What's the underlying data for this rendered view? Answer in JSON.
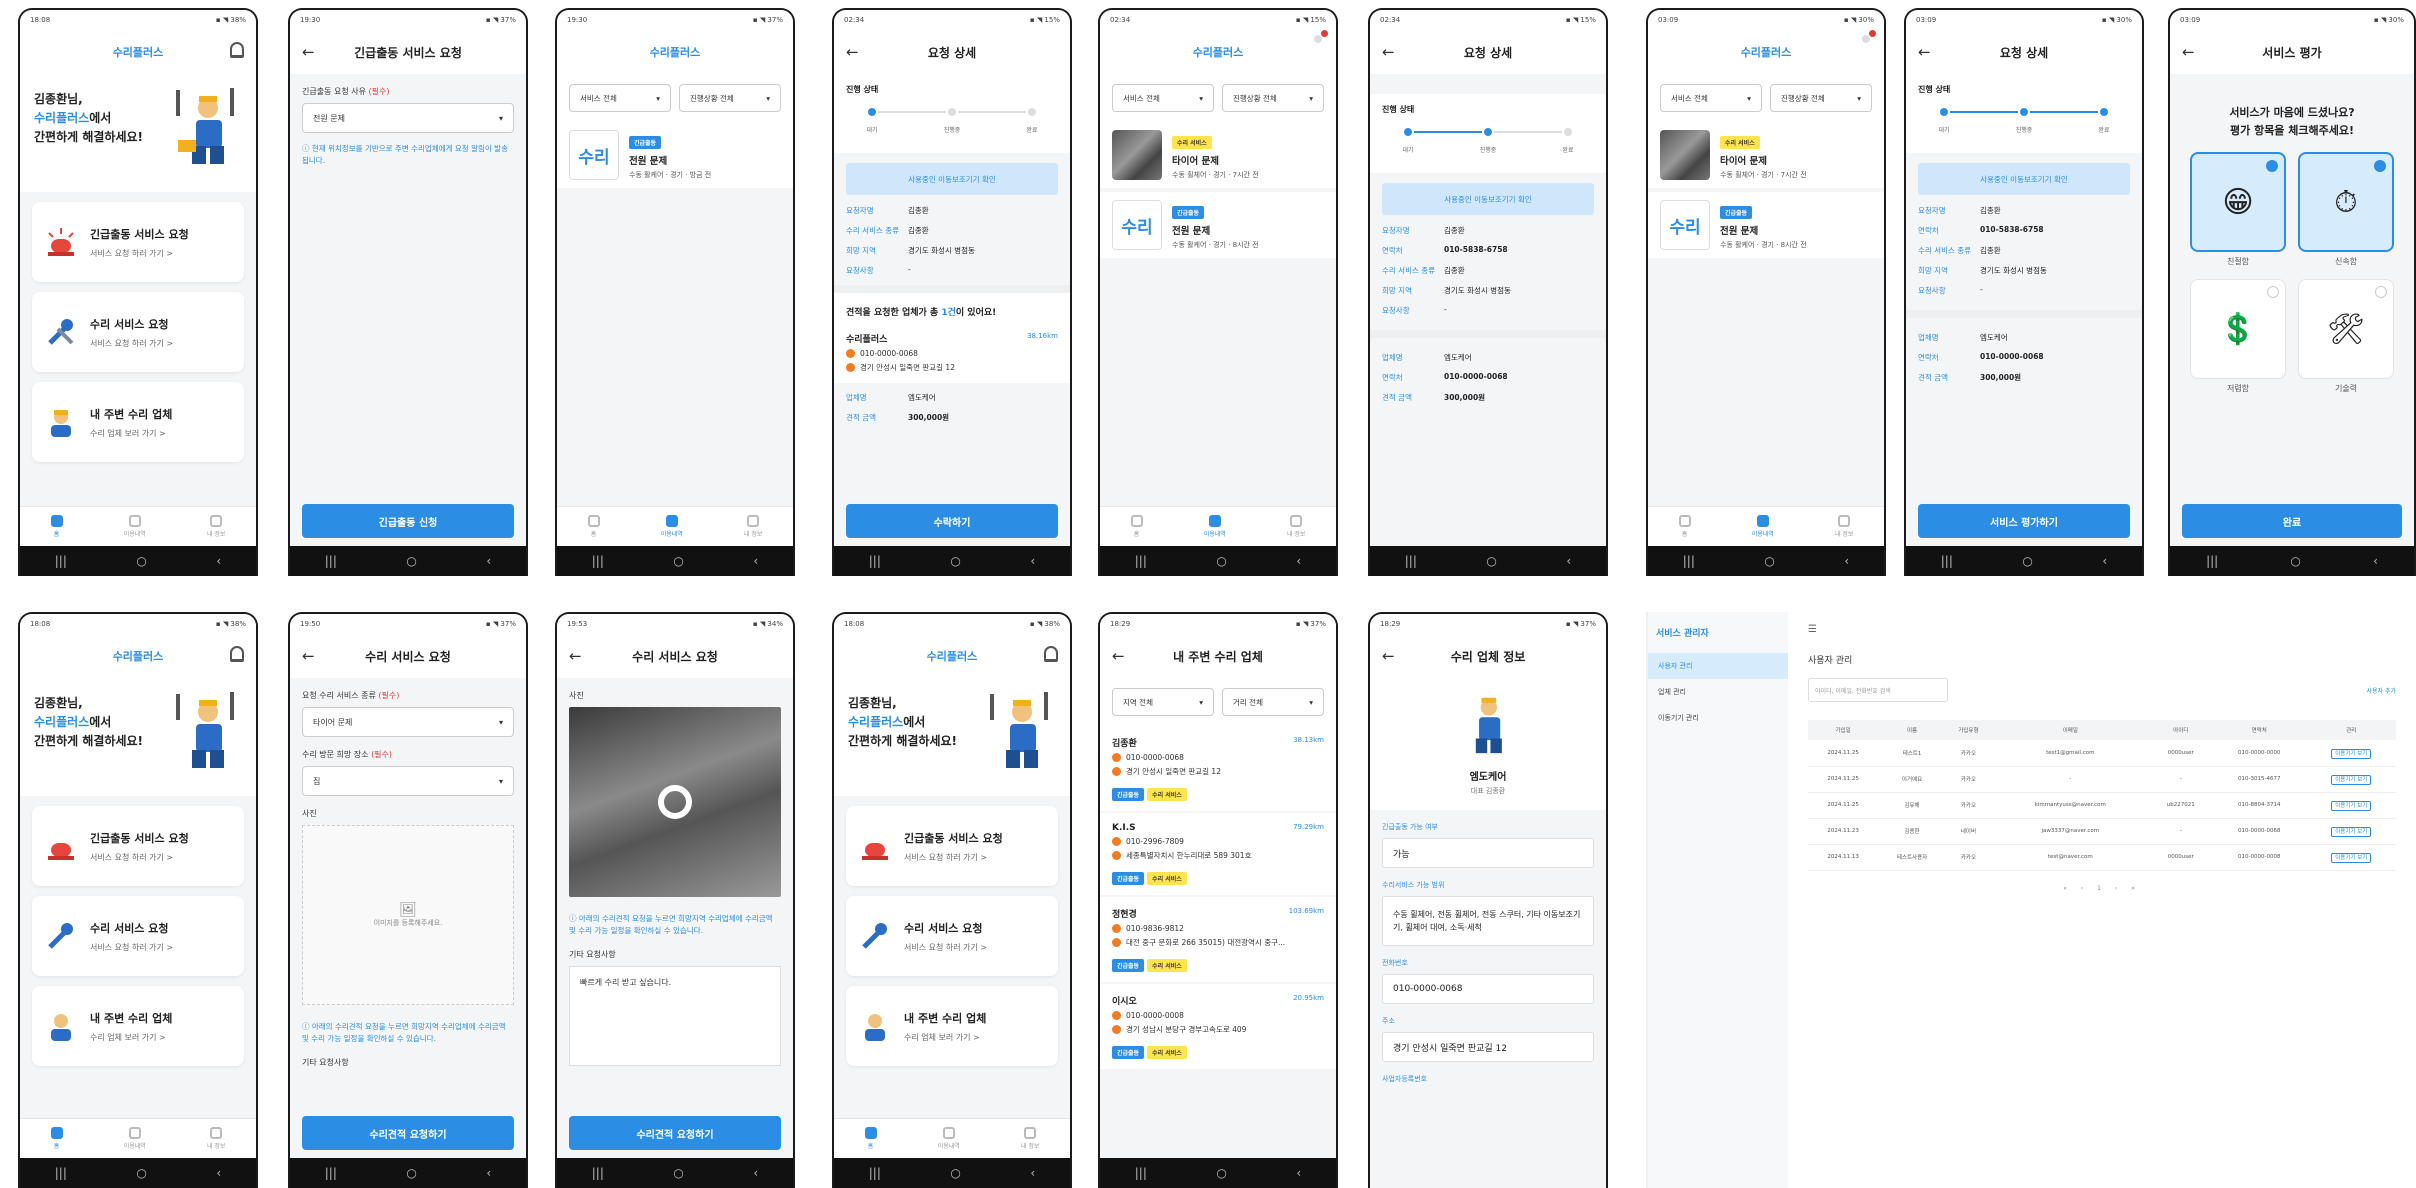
{
  "status_times": [
    "18:08",
    "19:30",
    "19:30",
    "02:34",
    "02:34",
    "02:34",
    "03:09",
    "03:09",
    "03:09",
    "18:08",
    "19:50",
    "19:53",
    "18:08",
    "18:29",
    "18:29"
  ],
  "brand": "수리플러스",
  "home": {
    "greeting_line1": "김종환님,",
    "greeting_brand": "수리플러스",
    "greeting_line2_suffix": "에서",
    "greeting_line3": "간편하게 해결하세요!",
    "menus": [
      {
        "title": "긴급출동 서비스 요청",
        "sub": "서비스 요청 하러 가기 >"
      },
      {
        "title": "수리 서비스 요청",
        "sub": "서비스 요청 하러 가기 >"
      },
      {
        "title": "내 주변 수리 업체",
        "sub": "수리 업체 보러 가기 >"
      }
    ],
    "tabs": [
      "홈",
      "이용내역",
      "내 정보"
    ]
  },
  "emergency": {
    "title": "긴급출동 서비스 요청",
    "field_label": "긴급출동 요청 사유",
    "required": "(필수)",
    "value": "전원 문제",
    "note": "ⓘ 현재 위치정보를 기반으로 주변 수리업체에게 요청 알림이 발송됩니다.",
    "submit": "긴급출동 신청"
  },
  "history": {
    "filter_service": "서비스 전체",
    "filter_status": "진행상황 전체",
    "items": [
      {
        "badge": "긴급출동",
        "badge_type": "b",
        "title": "전원 문제",
        "sub": "수동 활케어 · 경기 · 방금 전",
        "thumb": "repair"
      }
    ],
    "items2": [
      {
        "badge": "수리 서비스",
        "badge_type": "y",
        "title": "타이어 문제",
        "sub": "수동 휠체어 · 경기 · 7시간 전",
        "thumb": "photo"
      },
      {
        "badge": "긴급출동",
        "badge_type": "b",
        "title": "전원 문제",
        "sub": "수동 활케어 · 경기 · 8시간 전",
        "thumb": "repair"
      }
    ],
    "repair_thumb_text": "수리",
    "repair_thumb_tag": "긴급출동"
  },
  "detail": {
    "title": "요청 상세",
    "status_title": "진행 상태",
    "steps": [
      "대기",
      "진행중",
      "완료"
    ],
    "info_button": "사용중인 이동보조기기 확인",
    "rows_a": [
      {
        "k": "요청자명",
        "v": "김종환"
      },
      {
        "k": "수리 서비스 종류",
        "v": "김종환"
      },
      {
        "k": "희망 지역",
        "v": "경기도 화성시 병점동"
      },
      {
        "k": "요청사항",
        "v": "-"
      }
    ],
    "rows_b": [
      {
        "k": "요청자명",
        "v": "김종환"
      },
      {
        "k": "연락처",
        "v": "010-5838-6758"
      },
      {
        "k": "수리 서비스 종류",
        "v": "김종환"
      },
      {
        "k": "희망 지역",
        "v": "경기도 화성시 병점동"
      },
      {
        "k": "요청사항",
        "v": "-"
      }
    ],
    "quote_heading_pre": "견적을 요청한 업체가 총 ",
    "quote_count": "1건",
    "quote_heading_post": "이 있어요!",
    "vendor": {
      "name": "수리플러스",
      "dist": "38.16km",
      "phone": "010-0000-0068",
      "addr": "경기 안성시 일죽면 판교길 12"
    },
    "vendor_rows": [
      {
        "k": "업체명",
        "v": "엠도케어"
      },
      {
        "k": "견적 금액",
        "v": "300,000원"
      }
    ],
    "vendor_rows_b": [
      {
        "k": "업체명",
        "v": "엠도케어"
      },
      {
        "k": "연락처",
        "v": "010-0000-0068"
      },
      {
        "k": "견적 금액",
        "v": "300,000원"
      }
    ],
    "accept": "수락하기",
    "review_button": "서비스 평가하기"
  },
  "rating": {
    "title": "서비스 평가",
    "question_1": "서비스가 마음에 드셨나요?",
    "question_2": "평가 항목을 체크해주세요!",
    "items": [
      "친절함",
      "신속함",
      "저렴함",
      "기술력"
    ],
    "done": "완료"
  },
  "repair_request": {
    "title": "수리 서비스 요청",
    "type_label": "요청 수리 서비스 종류",
    "type_value": "타이어 문제",
    "place_label": "수리 방문 희망 장소",
    "place_value": "집",
    "photo_label": "사진",
    "photo_hint": "이미지를 등록해주세요.",
    "note": "ⓘ 아래의 수리견적 요청을 누르면 희망지역 수리업체에 수리금액 및 수리 가능 일정을 확인하실 수 있습니다.",
    "extra_label": "기타 요청사항",
    "extra_value": "빠르게 수리 받고 싶습니다.",
    "submit": "수리견적 요청하기"
  },
  "nearby": {
    "title": "내 주변 수리 업체",
    "filter_area": "지역 전체",
    "filter_dist": "거리 전체",
    "vendors": [
      {
        "name": "김종환",
        "dist": "38.13km",
        "phone": "010-0000-0068",
        "addr": "경기 안성시 일죽면 판교길 12"
      },
      {
        "name": "K.I.S",
        "dist": "79.29km",
        "phone": "010-2996-7809",
        "addr": "세종특별자치시 한누리대로 589 301호"
      },
      {
        "name": "정현경",
        "dist": "103.69km",
        "phone": "010-9836-9812",
        "addr": "대전 중구 문화로 266 35015) 대전광역시 중구..."
      },
      {
        "name": "이시오",
        "dist": "20.95km",
        "phone": "010-0000-0008",
        "addr": "경기 성남시 분당구 경부고속도로 409"
      }
    ],
    "tags": [
      "긴급출동",
      "수리 서비스"
    ]
  },
  "vendor_info": {
    "title": "수리 업체 정보",
    "name": "엠도케어",
    "ceo": "대표 김종환",
    "label_emergency": "긴급출동 가능 여부",
    "emergency": "가능",
    "label_services": "수리서비스 가능 범위",
    "services": "수동 휠체어, 전동 휠체어, 전동 스쿠터, 기타 이동보조기기, 휠체어 대여, 소독·세척",
    "label_phone": "전화번호",
    "phone": "010-0000-0068",
    "label_addr": "주소",
    "addr": "경기 안성시 일죽면 판교길 12",
    "label_biz": "사업자등록번호"
  },
  "admin": {
    "logo": "서비스 관리자",
    "nav": [
      "사용자 관리",
      "업체 관리",
      "이동기기 관리"
    ],
    "page_title": "사용자 관리",
    "search_placeholder": "아이디, 이메일, 전화번호 검색",
    "add_button": "사용자 추가",
    "columns": [
      "가입일",
      "이름",
      "가입유형",
      "이메일",
      "아이디",
      "연락처",
      "관리"
    ],
    "rows": [
      [
        "2024.11.25",
        "테스트1",
        "카카오",
        "test1@gmail.com",
        "0000user",
        "010-0000-0000",
        "이용기기 보기"
      ],
      [
        "2024.11.25",
        "이거예요",
        "카카오",
        "-",
        "-",
        "010-3015-4677",
        "이용기기 보기"
      ],
      [
        "2024.11.25",
        "김유해",
        "카카오",
        "kimmantyuss@naver.com",
        "ub227021",
        "010-8804-3714",
        "이용기기 보기"
      ],
      [
        "2024.11.23",
        "김종환",
        "네이버",
        "jaw3337@naver.com",
        "-",
        "010-0000-0068",
        "이용기기 보기"
      ],
      [
        "2024.11.13",
        "테스트사용자",
        "카카오",
        "test@naver.com",
        "0000user",
        "010-0000-0008",
        "이용기기 보기"
      ]
    ],
    "pager": "« ‹ 1 › »"
  },
  "colors": {
    "accent": "#2b8de3",
    "warning": "#f47c20",
    "badge_yellow": "#ffe44d"
  }
}
